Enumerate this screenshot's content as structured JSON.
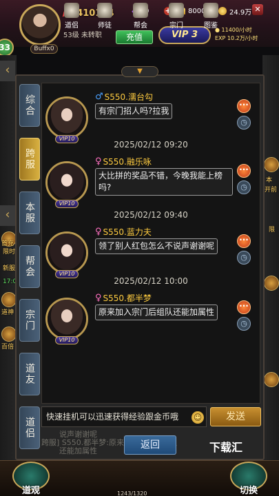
{
  "hud": {
    "power_prefix": "战",
    "power_value": ":410124",
    "gems": "0",
    "gold": "8000",
    "coins": "24.9万",
    "buff_label": "Buffx0",
    "left_badge": "33",
    "level_text": "53级 未转职",
    "recharge_label": "充值",
    "vip_label": "VIP 3",
    "rate_1": "11400/小时",
    "rate_2": "10.2万/小时",
    "exp_label": "EXP"
  },
  "tabs": [
    {
      "label": "综合",
      "active": false
    },
    {
      "label": "跨服",
      "active": true
    },
    {
      "label": "本服",
      "active": false
    },
    {
      "label": "帮会",
      "active": false
    },
    {
      "label": "宗门",
      "active": false
    },
    {
      "label": "道友",
      "active": false
    },
    {
      "label": "道侣",
      "active": false
    }
  ],
  "messages": [
    {
      "gender": "male",
      "gender_symbol": "♂",
      "name": "S550.濡台勾",
      "text": "有宗门招人吗?拉我",
      "vip": "VIP10"
    },
    {
      "gender": "female",
      "gender_symbol": "♀",
      "name": "S550.融乐咏",
      "text": "大比拼的奖品不错，今晚我能上榜吗?",
      "vip": "VIP10"
    },
    {
      "gender": "female",
      "gender_symbol": "♀",
      "name": "S550.蓝力夫",
      "text": "领了别人红包怎么不说声谢谢呢",
      "vip": "VIP10"
    },
    {
      "gender": "female",
      "gender_symbol": "♀",
      "name": "S550.都半梦",
      "text": "原来加入宗门后组队还能加属性",
      "vip": "VIP10"
    }
  ],
  "timestamps": [
    "2025/02/12  09:20",
    "2025/02/12  09:40",
    "2025/02/12  10:00"
  ],
  "input": {
    "placeholder": "快速挂机可以迅速获得经验跟金币哦"
  },
  "send_label": "发送",
  "back_label": "返回",
  "watermark": "下载汇",
  "ghost_lines": [
    "说声谢谢呢",
    "跨服] S550.都半梦:原来加入宗门后组队",
    "还能加属性"
  ],
  "side_labels": {
    "left": [
      "首充",
      "限时",
      "新服",
      "17:0",
      "道神",
      "百倍"
    ],
    "right": [
      "本",
      "开前",
      "限"
    ]
  },
  "bottom_nav": {
    "left_big": "道观",
    "right_big": "切换",
    "items": [
      "道侣",
      "师徒",
      "帮会",
      "宗门",
      "图鉴"
    ],
    "exp_text": "1243/1320"
  },
  "colors": {
    "accent_gold": "#c9a85a",
    "tab_active": "#d8b040",
    "male": "#4aa0ff",
    "female": "#ff70c0",
    "name": "#ffcc40"
  }
}
